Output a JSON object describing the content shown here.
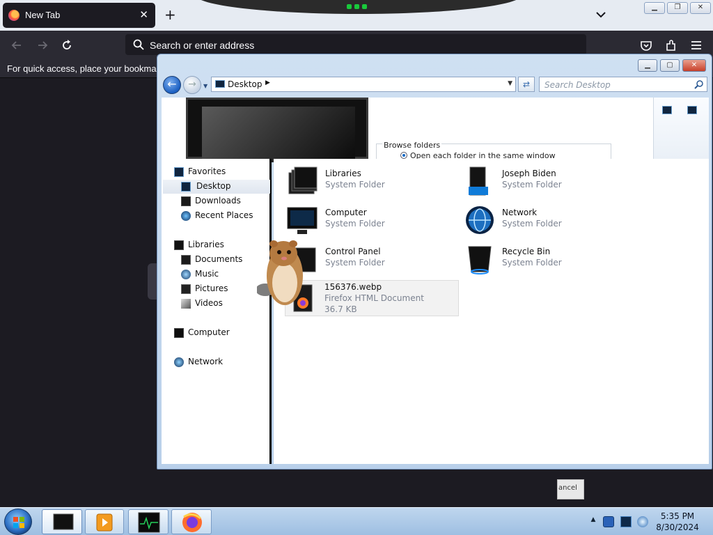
{
  "firefox": {
    "tab_title": "New Tab",
    "tab_close": "✕",
    "new_tab": "+",
    "address_placeholder": "Search or enter address",
    "bookmarks_hint": "For quick access, place your bookmarks here on the bookmarks toolbar.",
    "nav_icons": [
      "back-icon",
      "forward-icon",
      "reload-icon"
    ],
    "toolbar_icons": [
      "pocket-icon",
      "extensions-icon",
      "menu-icon"
    ],
    "window_buttons": [
      "minimize",
      "restore",
      "close"
    ]
  },
  "explorer": {
    "address_crumb": "Desktop",
    "search_placeholder": "Search Desktop",
    "background_dialog": {
      "legend": "Browse folders",
      "option": "Open each folder in the same window"
    },
    "navpane": {
      "favorites": "Favorites",
      "favorites_items": [
        "Desktop",
        "Downloads",
        "Recent Places"
      ],
      "libraries": "Libraries",
      "libraries_items": [
        "Documents",
        "Music",
        "Pictures",
        "Videos"
      ],
      "computer": "Computer",
      "network": "Network"
    },
    "items": [
      {
        "name": "Libraries",
        "type": "System Folder"
      },
      {
        "name": "Joseph Biden",
        "type": "System Folder"
      },
      {
        "name": "Computer",
        "type": "System Folder"
      },
      {
        "name": "Network",
        "type": "System Folder"
      },
      {
        "name": "Control Panel",
        "type": "System Folder"
      },
      {
        "name": "Recycle Bin",
        "type": "System Folder"
      },
      {
        "name": "156376.webp",
        "type": "Firefox HTML Document",
        "size": "36.7 KB"
      }
    ]
  },
  "drag_ghost_text": "ancel",
  "taskbar": {
    "time": "5:35 PM",
    "date": "8/30/2024",
    "tray_arrow": "▲"
  },
  "colors": {
    "firefox_dark": "#1c1b22",
    "firefox_toolbar": "#2b2a33",
    "aero_frame": "#b9d0ea",
    "taskbar": "#a9c7e6"
  }
}
